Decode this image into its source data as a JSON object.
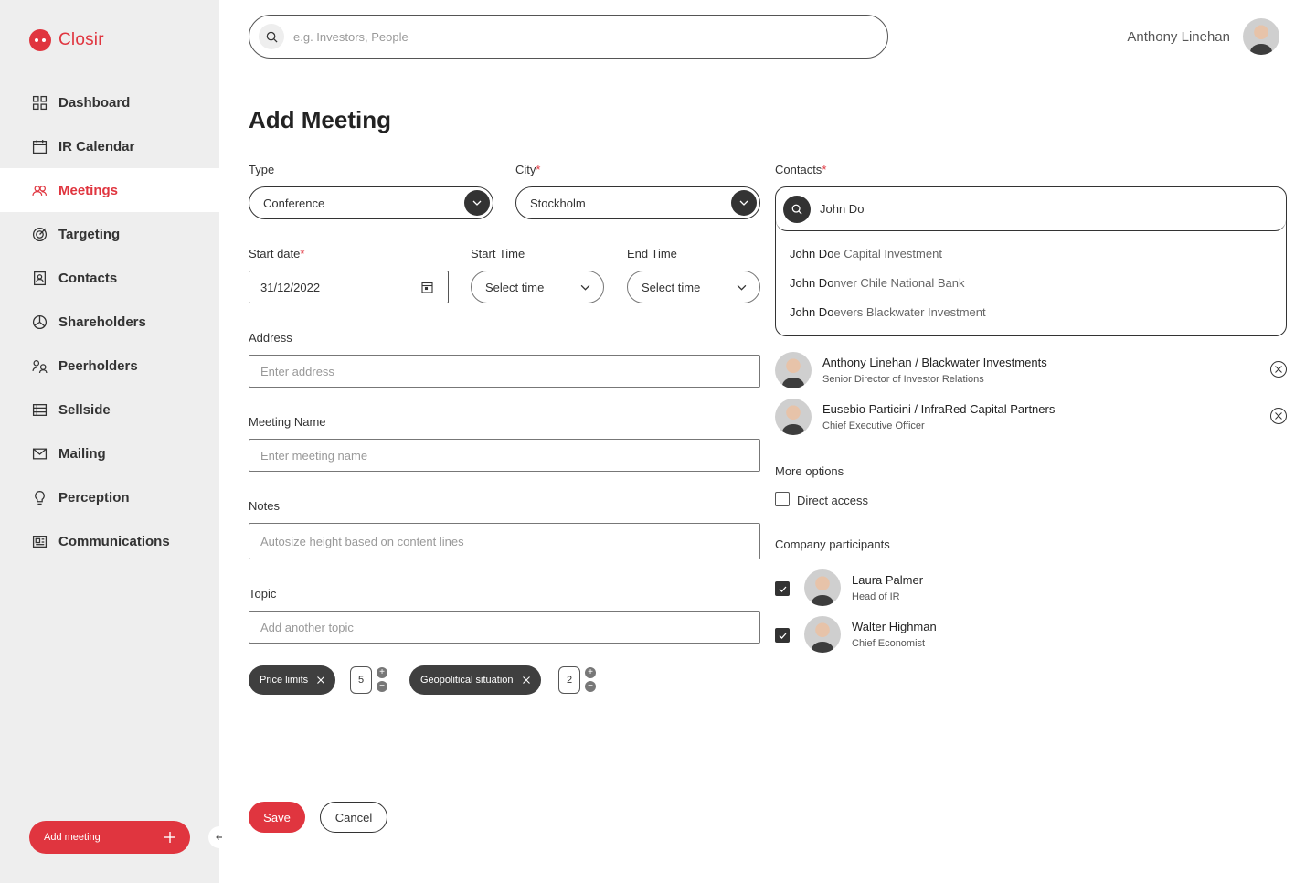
{
  "app": {
    "name": "Closir"
  },
  "sidebar": {
    "items": [
      {
        "label": "Dashboard",
        "icon": "grid-icon"
      },
      {
        "label": "IR Calendar",
        "icon": "calendar-icon"
      },
      {
        "label": "Meetings",
        "icon": "people-icon",
        "active": true
      },
      {
        "label": "Targeting",
        "icon": "target-icon"
      },
      {
        "label": "Contacts",
        "icon": "contact-card-icon"
      },
      {
        "label": "Shareholders",
        "icon": "pie-chart-icon"
      },
      {
        "label": "Peerholders",
        "icon": "peers-icon"
      },
      {
        "label": "Sellside",
        "icon": "table-icon"
      },
      {
        "label": "Mailing",
        "icon": "mail-icon"
      },
      {
        "label": "Perception",
        "icon": "lightbulb-icon"
      },
      {
        "label": "Communications",
        "icon": "news-icon"
      }
    ],
    "add_meeting_label": "Add meeting"
  },
  "header": {
    "search_placeholder": "e.g. Investors, People",
    "user_name": "Anthony Linehan"
  },
  "form": {
    "title": "Add Meeting",
    "type": {
      "label": "Type",
      "value": "Conference"
    },
    "city": {
      "label": "City",
      "value": "Stockholm"
    },
    "start_date": {
      "label": "Start date",
      "value": "31/12/2022"
    },
    "start_time": {
      "label": "Start Time",
      "value": "Select time"
    },
    "end_time": {
      "label": "End Time",
      "value": "Select time"
    },
    "address": {
      "label": "Address",
      "placeholder": "Enter address"
    },
    "meeting_name": {
      "label": "Meeting Name",
      "placeholder": "Enter meeting name"
    },
    "notes": {
      "label": "Notes",
      "placeholder": "Autosize height based on content lines"
    },
    "topic": {
      "label": "Topic",
      "placeholder": "Add another topic"
    },
    "topic_chips": [
      {
        "label": "Price limits",
        "count": "5"
      },
      {
        "label": "Geopolitical situation",
        "count": "2"
      }
    ],
    "save_label": "Save",
    "cancel_label": "Cancel"
  },
  "contacts": {
    "label": "Contacts",
    "query": "John Do",
    "suggestions": [
      {
        "match": "John Do",
        "rest": "e Capital Investment"
      },
      {
        "match": "John Do",
        "rest": "nver Chile National Bank"
      },
      {
        "match": "John Do",
        "rest": "evers Blackwater Investment"
      }
    ],
    "selected": [
      {
        "name": "Anthony Linehan / Blackwater Investments",
        "role": "Senior Director of Investor Relations"
      },
      {
        "name": "Eusebio Particini / InfraRed Capital Partners",
        "role": "Chief Executive Officer"
      }
    ]
  },
  "more_options": {
    "label": "More options",
    "direct_access_label": "Direct access",
    "direct_access_checked": false
  },
  "participants": {
    "label": "Company participants",
    "items": [
      {
        "name": "Laura Palmer",
        "role": "Head of IR",
        "checked": true
      },
      {
        "name": "Walter Highman",
        "role": "Chief Economist",
        "checked": true
      }
    ]
  },
  "colors": {
    "accent": "#e0353f",
    "dark": "#333333",
    "sidebar_bg": "#eeeeee"
  }
}
